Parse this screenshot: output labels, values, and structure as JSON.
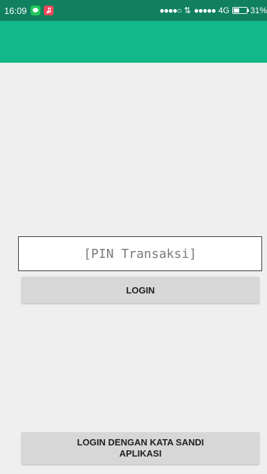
{
  "status_bar": {
    "time": "16:09",
    "signal_1": "●●●●○",
    "data_arrows": "⇅",
    "signal_2": "●●●●●",
    "network": "4G",
    "battery_percent": "31%",
    "battery_level": 0.31
  },
  "form": {
    "pin_placeholder": "[PIN Transaksi]",
    "login_label": "LOGIN",
    "login_password_label": "LOGIN DENGAN KATA SANDI APLIKASI"
  },
  "colors": {
    "status_bar": "#10805e",
    "app_bar": "#13b88a",
    "background": "#efefef",
    "button": "#d7d7d7"
  }
}
